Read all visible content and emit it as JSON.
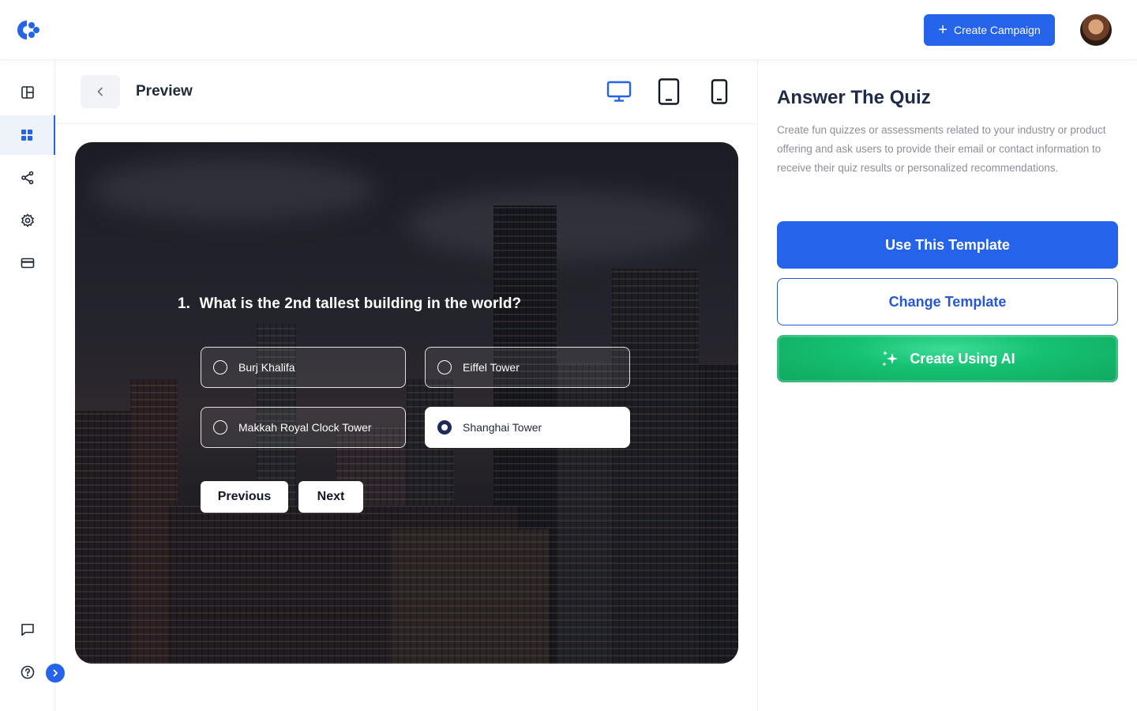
{
  "header": {
    "logo_icon": "brand-logo-icon",
    "create_campaign_label": "Create Campaign",
    "accent_color": "#2563eb"
  },
  "sidebar": {
    "items": [
      {
        "name": "layout-icon"
      },
      {
        "name": "grid-icon",
        "active": true
      },
      {
        "name": "share-icon"
      },
      {
        "name": "gear-icon"
      },
      {
        "name": "credit-card-icon"
      },
      {
        "name": "chat-icon"
      },
      {
        "name": "help-icon"
      }
    ],
    "expand_icon": "chevron-right-icon"
  },
  "preview": {
    "title": "Preview",
    "devices": [
      {
        "name": "desktop-icon",
        "active": true
      },
      {
        "name": "tablet-icon",
        "active": false
      },
      {
        "name": "mobile-icon",
        "active": false
      }
    ]
  },
  "quiz": {
    "question_number": "1.",
    "question": "What is the 2nd tallest building in the world?",
    "options": [
      {
        "label": "Burj Khalifa",
        "selected": false
      },
      {
        "label": "Eiffel Tower",
        "selected": false
      },
      {
        "label": "Makkah Royal Clock Tower",
        "selected": false
      },
      {
        "label": "Shanghai Tower",
        "selected": true
      }
    ],
    "previous_label": "Previous",
    "next_label": "Next"
  },
  "panel": {
    "title": "Answer The Quiz",
    "description": "Create fun quizzes or assessments related to your industry or product offering and ask users to provide their email or contact information to receive their quiz results or personalized recommendations.",
    "use_template_label": "Use This Template",
    "change_template_label": "Change Template",
    "create_ai_label": "Create Using AI"
  }
}
